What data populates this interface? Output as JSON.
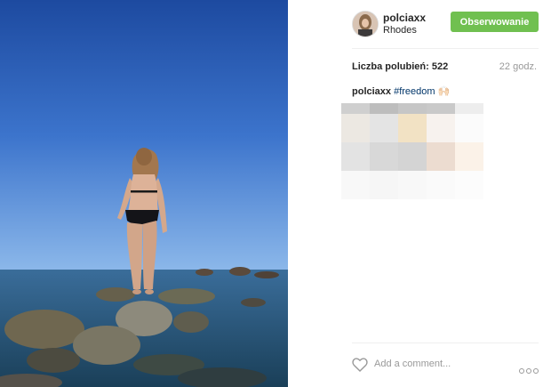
{
  "post": {
    "username": "polciaxx",
    "location": "Rhodes",
    "follow_label": "Obserwowanie",
    "likes_text": "Liczba polubień: 522",
    "time_ago": "22 godz.",
    "caption_user": "polciaxx",
    "caption_hashtag": "#freedom",
    "caption_emoji": "🙌🏻",
    "comment_placeholder": "Add a comment..."
  },
  "colors": {
    "follow_button": "#70c050",
    "hashtag": "#003569",
    "sky_top": "#1d4aa0",
    "sky_bottom": "#8cb8ea"
  },
  "icons": {
    "like": "heart-outline-icon",
    "more": "more-dots-icon"
  }
}
